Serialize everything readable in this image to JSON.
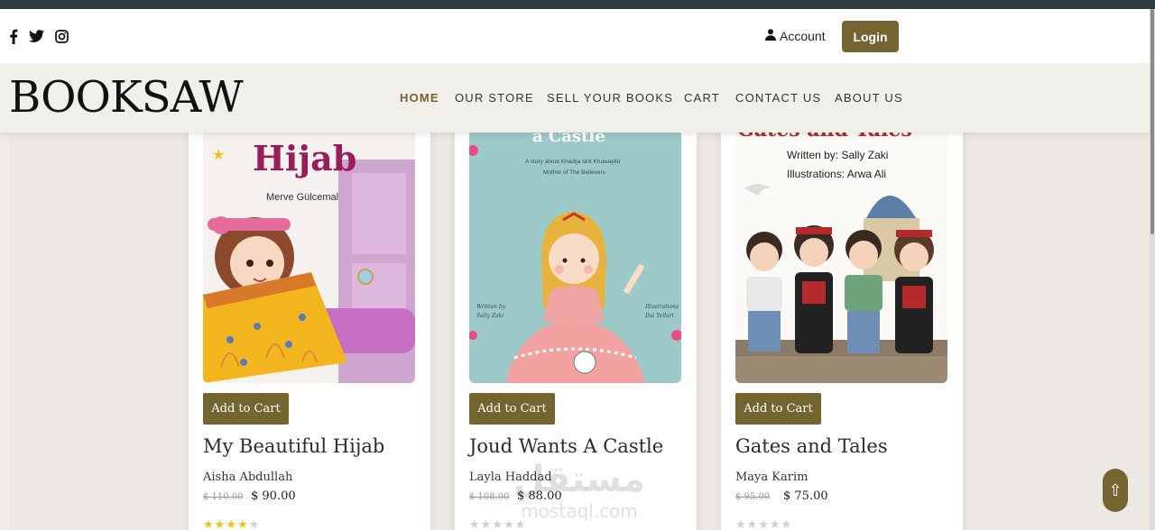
{
  "topbar": {
    "social": [
      "facebook-icon",
      "twitter-icon",
      "instagram-icon"
    ],
    "account_label": "Account",
    "login_label": "Login"
  },
  "brand": {
    "logo": "BOOKSAW"
  },
  "nav": {
    "items": [
      "HOME",
      "OUR STORE",
      "SELL YOUR BOOKS",
      "CART",
      "CONTACT US",
      "ABOUT US"
    ],
    "active": "HOME"
  },
  "colors": {
    "accent": "#74642f",
    "topstrip": "#2e3d3f",
    "page_bg": "#efebe6"
  },
  "products": [
    {
      "cover_title": "Hijab",
      "cover_author": "Merve Gülcemal",
      "cart_label": "Add to Cart",
      "title": "My Beautiful Hijab",
      "author": "Aisha Abdullah",
      "old_price": "$ 110.00",
      "price": "$ 90.00",
      "rating": 4
    },
    {
      "cover_title": "a Castle",
      "cover_subtitle": "A story about Khadija bint Khuwaylid",
      "cover_subtitle2": "Mother of The Believers",
      "cover_written": "Written by",
      "cover_writer": "Sally Zaki",
      "cover_illus": "Illustrations",
      "cover_illustrator": "Dai Yelluri",
      "cart_label": "Add to Cart",
      "title": "Joud Wants A Castle",
      "author": "Layla Haddad",
      "old_price": "$ 108.00",
      "price": "$ 88.00",
      "rating": 0
    },
    {
      "cover_title": "Gates and Tales",
      "cover_written": "Written by: Sally Zaki",
      "cover_illus": "Illustrations: Arwa Ali",
      "cart_label": "Add to Cart",
      "title": "Gates and Tales",
      "author": "Maya Karim",
      "old_price": "$ 95.00",
      "price": "$ 75.00",
      "rating": 0
    }
  ],
  "watermark": {
    "arabic": "مستقل",
    "latin": "mostaql.com"
  },
  "scroll_top": {
    "icon": "arrow-up-icon",
    "glyph": "⇧"
  }
}
